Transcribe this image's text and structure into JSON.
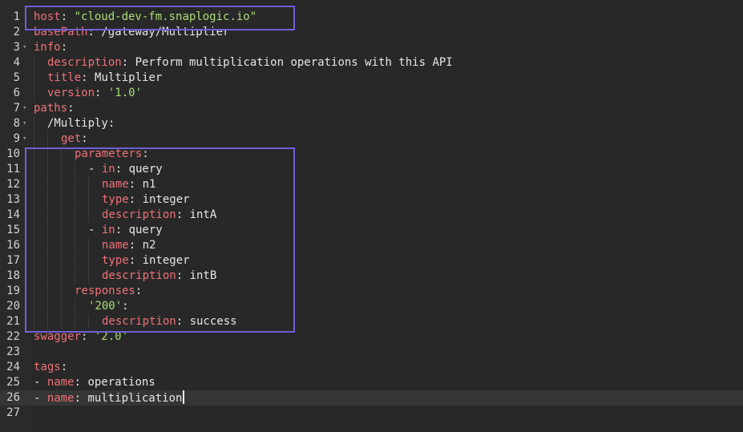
{
  "editor": {
    "lines": [
      {
        "n": "1",
        "indent": 0,
        "fold": false,
        "parts": [
          [
            "key",
            "host"
          ],
          [
            "pun",
            ": "
          ],
          [
            "str",
            "\"cloud-dev-fm.snaplogic.io\""
          ]
        ]
      },
      {
        "n": "2",
        "indent": 0,
        "fold": false,
        "parts": [
          [
            "key",
            "basePath"
          ],
          [
            "pun",
            ": "
          ],
          [
            "val",
            "/gateway/Multiplier"
          ]
        ]
      },
      {
        "n": "3",
        "indent": 0,
        "fold": true,
        "parts": [
          [
            "key",
            "info"
          ],
          [
            "pun",
            ":"
          ]
        ]
      },
      {
        "n": "4",
        "indent": 1,
        "fold": false,
        "parts": [
          [
            "key",
            "description"
          ],
          [
            "pun",
            ": "
          ],
          [
            "val",
            "Perform multiplication operations with this API"
          ]
        ]
      },
      {
        "n": "5",
        "indent": 1,
        "fold": false,
        "parts": [
          [
            "key",
            "title"
          ],
          [
            "pun",
            ": "
          ],
          [
            "val",
            "Multiplier"
          ]
        ]
      },
      {
        "n": "6",
        "indent": 1,
        "fold": false,
        "parts": [
          [
            "key",
            "version"
          ],
          [
            "pun",
            ": "
          ],
          [
            "str",
            "'1.0'"
          ]
        ]
      },
      {
        "n": "7",
        "indent": 0,
        "fold": true,
        "parts": [
          [
            "key",
            "paths"
          ],
          [
            "pun",
            ":"
          ]
        ]
      },
      {
        "n": "8",
        "indent": 1,
        "fold": true,
        "parts": [
          [
            "val",
            "/Multiply"
          ],
          [
            "pun",
            ":"
          ]
        ]
      },
      {
        "n": "9",
        "indent": 2,
        "fold": true,
        "parts": [
          [
            "key",
            "get"
          ],
          [
            "pun",
            ":"
          ]
        ]
      },
      {
        "n": "10",
        "indent": 3,
        "fold": false,
        "parts": [
          [
            "key",
            "parameters"
          ],
          [
            "pun",
            ":"
          ]
        ]
      },
      {
        "n": "11",
        "indent": 4,
        "fold": false,
        "parts": [
          [
            "pun",
            "- "
          ],
          [
            "key",
            "in"
          ],
          [
            "pun",
            ": "
          ],
          [
            "val",
            "query"
          ]
        ]
      },
      {
        "n": "12",
        "indent": 5,
        "fold": false,
        "parts": [
          [
            "key",
            "name"
          ],
          [
            "pun",
            ": "
          ],
          [
            "val",
            "n1"
          ]
        ]
      },
      {
        "n": "13",
        "indent": 5,
        "fold": false,
        "parts": [
          [
            "key",
            "type"
          ],
          [
            "pun",
            ": "
          ],
          [
            "val",
            "integer"
          ]
        ]
      },
      {
        "n": "14",
        "indent": 5,
        "fold": false,
        "parts": [
          [
            "key",
            "description"
          ],
          [
            "pun",
            ": "
          ],
          [
            "val",
            "intA"
          ]
        ]
      },
      {
        "n": "15",
        "indent": 4,
        "fold": false,
        "parts": [
          [
            "pun",
            "- "
          ],
          [
            "key",
            "in"
          ],
          [
            "pun",
            ": "
          ],
          [
            "val",
            "query"
          ]
        ]
      },
      {
        "n": "16",
        "indent": 5,
        "fold": false,
        "parts": [
          [
            "key",
            "name"
          ],
          [
            "pun",
            ": "
          ],
          [
            "val",
            "n2"
          ]
        ]
      },
      {
        "n": "17",
        "indent": 5,
        "fold": false,
        "parts": [
          [
            "key",
            "type"
          ],
          [
            "pun",
            ": "
          ],
          [
            "val",
            "integer"
          ]
        ]
      },
      {
        "n": "18",
        "indent": 5,
        "fold": false,
        "parts": [
          [
            "key",
            "description"
          ],
          [
            "pun",
            ": "
          ],
          [
            "val",
            "intB"
          ]
        ]
      },
      {
        "n": "19",
        "indent": 3,
        "fold": false,
        "parts": [
          [
            "key",
            "responses"
          ],
          [
            "pun",
            ":"
          ]
        ]
      },
      {
        "n": "20",
        "indent": 4,
        "fold": false,
        "parts": [
          [
            "str",
            "'200'"
          ],
          [
            "pun",
            ":"
          ]
        ]
      },
      {
        "n": "21",
        "indent": 5,
        "fold": false,
        "parts": [
          [
            "key",
            "description"
          ],
          [
            "pun",
            ": "
          ],
          [
            "val",
            "success"
          ]
        ]
      },
      {
        "n": "22",
        "indent": 0,
        "fold": false,
        "parts": [
          [
            "key",
            "swagger"
          ],
          [
            "pun",
            ": "
          ],
          [
            "str",
            "'2.0'"
          ]
        ]
      },
      {
        "n": "23",
        "indent": 0,
        "fold": false,
        "parts": []
      },
      {
        "n": "24",
        "indent": 0,
        "fold": false,
        "parts": [
          [
            "key",
            "tags"
          ],
          [
            "pun",
            ":"
          ]
        ]
      },
      {
        "n": "25",
        "indent": 0,
        "fold": false,
        "parts": [
          [
            "pun",
            "- "
          ],
          [
            "key",
            "name"
          ],
          [
            "pun",
            ": "
          ],
          [
            "val",
            "operations"
          ]
        ]
      },
      {
        "n": "26",
        "indent": 0,
        "fold": false,
        "active": true,
        "cursor": true,
        "parts": [
          [
            "pun",
            "- "
          ],
          [
            "key",
            "name"
          ],
          [
            "pun",
            ": "
          ],
          [
            "val",
            "multiplication"
          ]
        ]
      },
      {
        "n": "27",
        "indent": 0,
        "fold": false,
        "parts": []
      }
    ],
    "fold_glyph": "▾"
  },
  "colors": {
    "background": "#282828",
    "key": "#f07178",
    "string": "#a9dc76",
    "value": "#e6e6e6",
    "line_number": "#d4d4d4",
    "highlight_box": "#6f5fd6",
    "active_line": "#353535"
  },
  "annotations": [
    {
      "label": "host-highlight-box",
      "from_line": 1,
      "to_line": 1
    },
    {
      "label": "parameters-highlight-box",
      "from_line": 10,
      "to_line": 21
    }
  ]
}
